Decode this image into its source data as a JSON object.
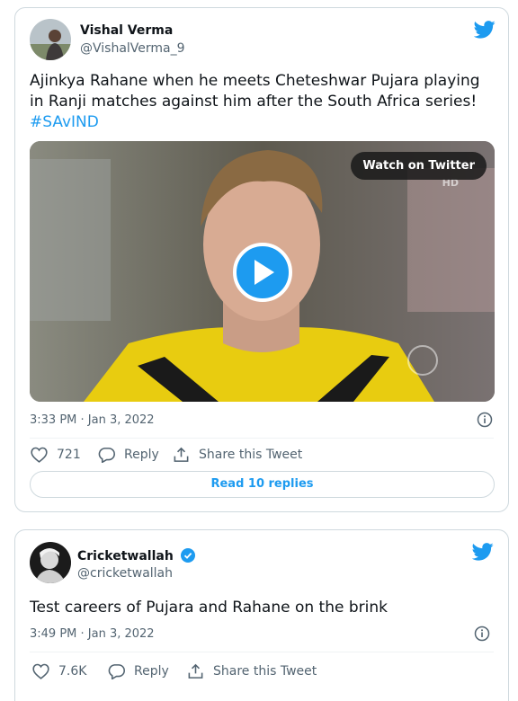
{
  "tweets": [
    {
      "author_name": "Vishal Verma",
      "author_handle": "@VishalVerma_9",
      "text": "Ajinkya Rahane when he meets Cheteshwar Pujara playing in Ranji matches against him after the South Africa series!",
      "hashtag": "#SAvIND",
      "video": {
        "watch_label": "Watch on Twitter",
        "hd_label": "HD"
      },
      "timestamp": "3:33 PM · Jan 3, 2022",
      "likes": "721",
      "reply_label": "Reply",
      "share_label": "Share this Tweet",
      "read_replies_label": "Read 10 replies"
    },
    {
      "author_name": "Cricketwallah",
      "author_handle": "@cricketwallah",
      "verified": true,
      "text": "Test careers of Pujara and Rahane on the brink",
      "timestamp": "3:49 PM · Jan 3, 2022",
      "likes": "7.6K",
      "reply_label": "Reply",
      "share_label": "Share this Tweet"
    }
  ],
  "colors": {
    "accent": "#1d9bf0",
    "text_primary": "#0f1419",
    "text_secondary": "#536471",
    "border": "#cfd9de"
  },
  "icons": [
    "twitter-bird-icon",
    "heart-icon",
    "reply-icon",
    "share-icon",
    "info-icon",
    "play-icon",
    "verified-badge-icon"
  ]
}
